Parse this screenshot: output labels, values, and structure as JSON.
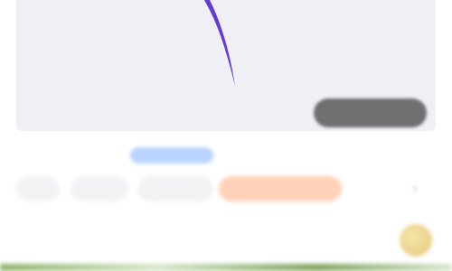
{
  "media": {
    "overlay_label": ""
  },
  "meta": {
    "left_text": "",
    "link_text": ""
  },
  "chips": [
    {
      "label": ""
    },
    {
      "label": ""
    },
    {
      "label": ""
    },
    {
      "label": ""
    }
  ],
  "headline": {
    "text": ""
  },
  "colors": {
    "media_bg": "#eff0f6",
    "stroke_purple": "#5b2fd6",
    "chip_orange_bg": "#ffd1b8",
    "chip_orange_text": "#ff7a3d",
    "link_blue": "#b9d4ff",
    "headline": "#3a3a48"
  },
  "icons": {
    "chevron": "chevron-right-icon"
  }
}
